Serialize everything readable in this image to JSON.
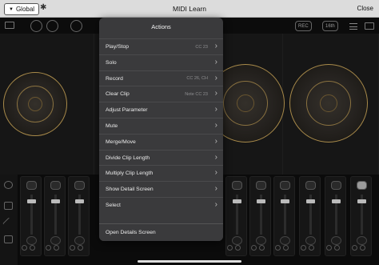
{
  "top_bar": {
    "scope_button_label": "Global",
    "bluetooth_icon": "bluetooth-icon",
    "title": "MIDI Learn",
    "close_label": "Close"
  },
  "background_app": {
    "toolbar_pills": [
      "REC",
      "16th"
    ]
  },
  "actions_popover": {
    "title": "Actions",
    "items": [
      {
        "label": "Play/Stop",
        "assignment": "CC 23"
      },
      {
        "label": "Solo",
        "assignment": ""
      },
      {
        "label": "Record",
        "assignment": "CC 26, CH"
      },
      {
        "label": "Clear Clip",
        "assignment": "Note CC 23"
      },
      {
        "label": "Adjust Parameter",
        "assignment": ""
      },
      {
        "label": "Mute",
        "assignment": ""
      },
      {
        "label": "Merge/Move",
        "assignment": ""
      },
      {
        "label": "Divide Clip Length",
        "assignment": ""
      },
      {
        "label": "Multiply Clip Length",
        "assignment": ""
      },
      {
        "label": "Show Detail Screen",
        "assignment": ""
      },
      {
        "label": "Select",
        "assignment": ""
      }
    ],
    "footer_item": "Open Details Screen"
  }
}
